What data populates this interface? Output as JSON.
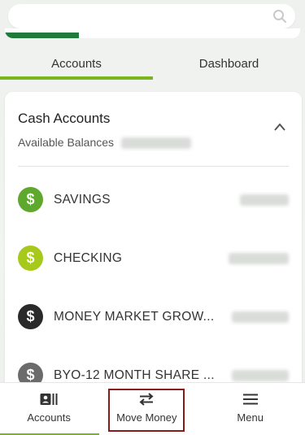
{
  "search": {
    "placeholder": ""
  },
  "onboarding": {
    "progress_percent": 25
  },
  "tabs": [
    {
      "label": "Accounts",
      "active": true
    },
    {
      "label": "Dashboard",
      "active": false
    }
  ],
  "card": {
    "title": "Cash Accounts",
    "subtitle": "Available Balances",
    "collapse_icon": "chevron-up-icon"
  },
  "accounts": [
    {
      "name": "SAVINGS",
      "icon": "dollar-icon",
      "color": "#5fa82e"
    },
    {
      "name": "CHECKING",
      "icon": "dollar-icon",
      "color": "#a6c91b"
    },
    {
      "name": "MONEY MARKET GROW...",
      "icon": "dollar-icon",
      "color": "#2a2a2a"
    },
    {
      "name": "BYO-12 MONTH SHARE ...",
      "icon": "dollar-icon",
      "color": "#6b6b6b"
    }
  ],
  "bottom_nav": [
    {
      "label": "Accounts",
      "icon": "accounts-icon",
      "active": true
    },
    {
      "label": "Move Money",
      "icon": "transfer-arrows-icon",
      "active": false
    },
    {
      "label": "Menu",
      "icon": "hamburger-menu-icon",
      "active": false
    }
  ],
  "colors": {
    "accent_green": "#7ab51d",
    "brand_dark_green": "#1f7a3c",
    "highlight_border": "#8b1a1a"
  }
}
